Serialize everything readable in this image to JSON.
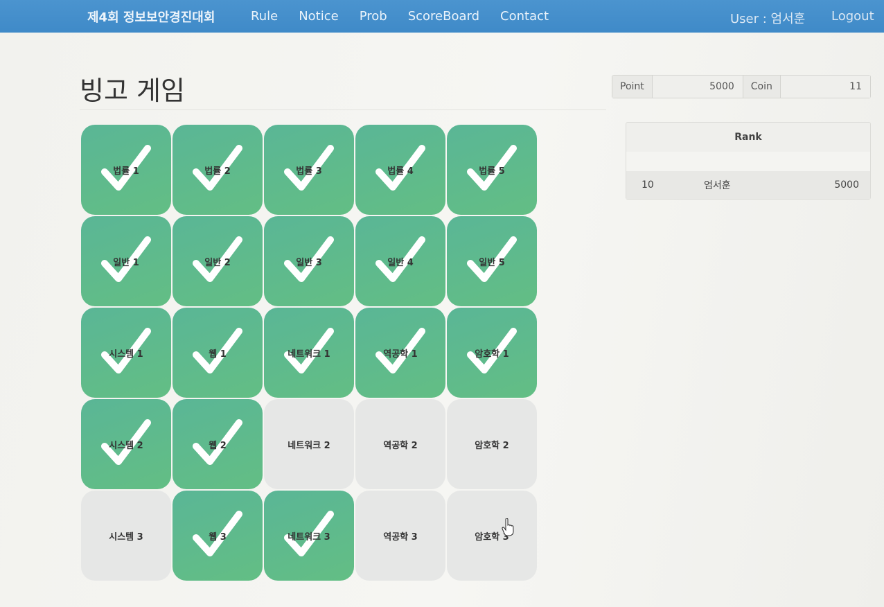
{
  "navbar": {
    "brand": "제4회 정보보안경진대회",
    "links": [
      "Rule",
      "Notice",
      "Prob",
      "ScoreBoard",
      "Contact"
    ],
    "user": "User : 엄서훈",
    "logout": "Logout"
  },
  "page": {
    "title": "빙고 게임"
  },
  "stats": {
    "point_label": "Point",
    "point_value": "5000",
    "coin_label": "Coin",
    "coin_value": "11"
  },
  "rank": {
    "header": "Rank",
    "rows": [
      {
        "position": "10",
        "name": "엄서훈",
        "score": "5000"
      }
    ]
  },
  "board": {
    "cells": [
      {
        "label": "법률 1",
        "solved": true
      },
      {
        "label": "법률 2",
        "solved": true
      },
      {
        "label": "법률 3",
        "solved": true
      },
      {
        "label": "법률 4",
        "solved": true
      },
      {
        "label": "법률 5",
        "solved": true
      },
      {
        "label": "일반 1",
        "solved": true
      },
      {
        "label": "일반 2",
        "solved": true
      },
      {
        "label": "일반 3",
        "solved": true
      },
      {
        "label": "일반 4",
        "solved": true
      },
      {
        "label": "일반 5",
        "solved": true
      },
      {
        "label": "시스템 1",
        "solved": true
      },
      {
        "label": "웹 1",
        "solved": true
      },
      {
        "label": "네트워크 1",
        "solved": true
      },
      {
        "label": "역공학 1",
        "solved": true
      },
      {
        "label": "암호학 1",
        "solved": true
      },
      {
        "label": "시스템 2",
        "solved": true
      },
      {
        "label": "웹 2",
        "solved": true
      },
      {
        "label": "네트워크 2",
        "solved": false
      },
      {
        "label": "역공학 2",
        "solved": false
      },
      {
        "label": "암호학 2",
        "solved": false
      },
      {
        "label": "시스템 3",
        "solved": false
      },
      {
        "label": "웹 3",
        "solved": true
      },
      {
        "label": "네트워크 3",
        "solved": true
      },
      {
        "label": "역공학 3",
        "solved": false
      },
      {
        "label": "암호학 3",
        "solved": false
      }
    ]
  },
  "icons": {
    "solved_mark": "check-icon",
    "pointer": "hand-cursor-icon"
  }
}
